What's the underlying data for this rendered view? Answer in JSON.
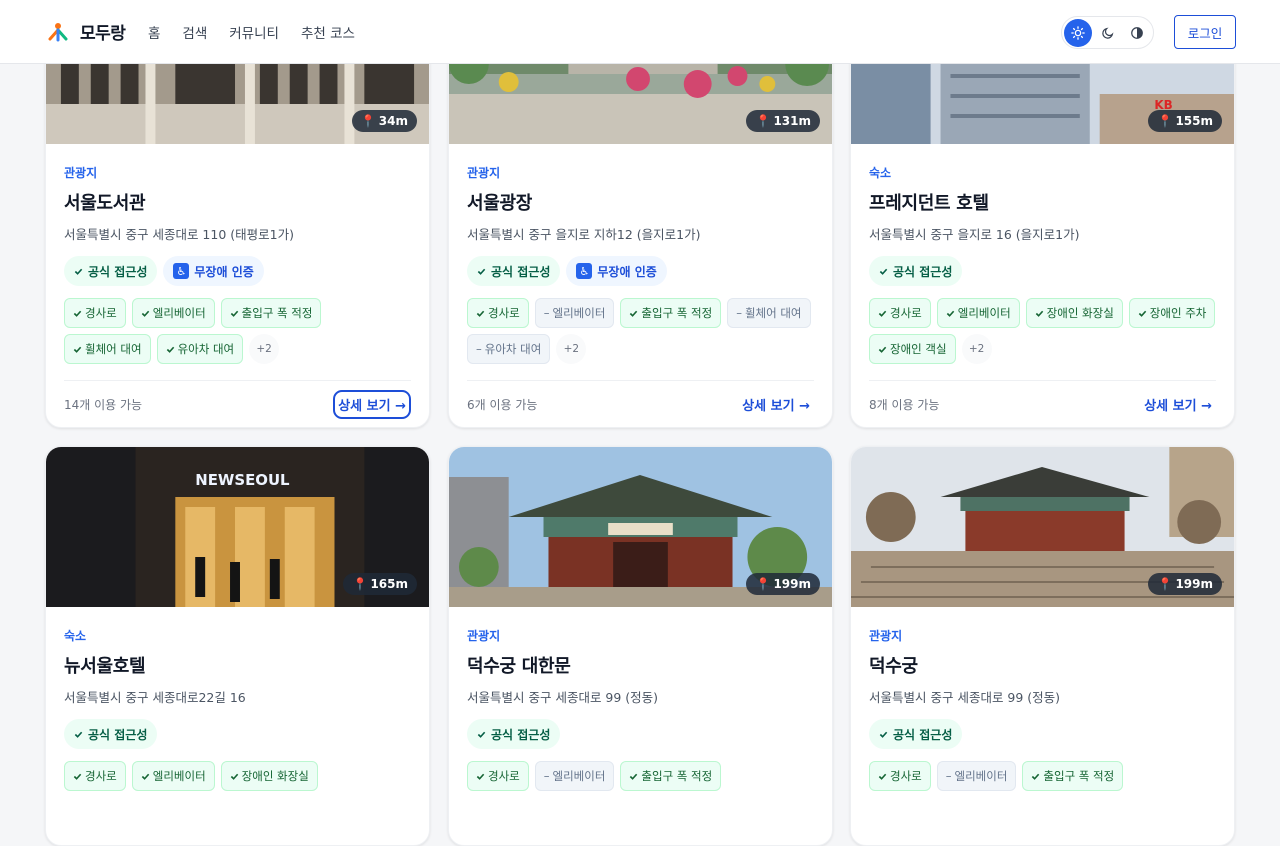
{
  "header": {
    "logo_text": "모두랑",
    "nav": [
      "홈",
      "검색",
      "커뮤니티",
      "추천 코스"
    ],
    "login_label": "로그인"
  },
  "colors": {
    "accent": "#2563eb",
    "green": "#065f46",
    "chip_ok_bg": "#ecfdf5"
  },
  "cards": [
    {
      "category": "관광지",
      "name": "서울도서관",
      "address": "서울특별시 중구 세종대로 110 (태평로1가)",
      "distance": "34m",
      "badges": [
        {
          "label": "공식 접근성",
          "kind": "green",
          "icon": "check-icon"
        },
        {
          "label": "무장애 인증",
          "kind": "blue",
          "icon": "wheelchair-icon"
        }
      ],
      "chips": [
        {
          "label": "경사로",
          "ok": true
        },
        {
          "label": "엘리베이터",
          "ok": true
        },
        {
          "label": "출입구 폭 적정",
          "ok": true
        },
        {
          "label": "휠체어 대여",
          "ok": true
        },
        {
          "label": "유아차 대여",
          "ok": true
        }
      ],
      "more": "+2",
      "available": "14개 이용 가능",
      "detail_label": "상세 보기 →",
      "focused": true
    },
    {
      "category": "관광지",
      "name": "서울광장",
      "address": "서울특별시 중구 을지로 지하12 (을지로1가)",
      "distance": "131m",
      "badges": [
        {
          "label": "공식 접근성",
          "kind": "green",
          "icon": "check-icon"
        },
        {
          "label": "무장애 인증",
          "kind": "blue",
          "icon": "wheelchair-icon"
        }
      ],
      "chips": [
        {
          "label": "경사로",
          "ok": true
        },
        {
          "label": "엘리베이터",
          "ok": false
        },
        {
          "label": "출입구 폭 적정",
          "ok": true
        },
        {
          "label": "휠체어 대여",
          "ok": false
        },
        {
          "label": "유아차 대여",
          "ok": false
        }
      ],
      "more": "+2",
      "available": "6개 이용 가능",
      "detail_label": "상세 보기 →",
      "focused": false
    },
    {
      "category": "숙소",
      "name": "프레지던트 호텔",
      "address": "서울특별시 중구 을지로 16 (을지로1가)",
      "distance": "155m",
      "badges": [
        {
          "label": "공식 접근성",
          "kind": "green",
          "icon": "check-icon"
        }
      ],
      "chips": [
        {
          "label": "경사로",
          "ok": true
        },
        {
          "label": "엘리베이터",
          "ok": true
        },
        {
          "label": "장애인 화장실",
          "ok": true
        },
        {
          "label": "장애인 주차",
          "ok": true
        },
        {
          "label": "장애인 객실",
          "ok": true
        }
      ],
      "more": "+2",
      "available": "8개 이용 가능",
      "detail_label": "상세 보기 →",
      "focused": false
    },
    {
      "category": "숙소",
      "name": "뉴서울호텔",
      "address": "서울특별시 중구 세종대로22길 16",
      "distance": "165m",
      "badges": [
        {
          "label": "공식 접근성",
          "kind": "green",
          "icon": "check-icon"
        }
      ],
      "chips": [
        {
          "label": "경사로",
          "ok": true
        },
        {
          "label": "엘리베이터",
          "ok": true
        },
        {
          "label": "장애인 화장실",
          "ok": true
        }
      ],
      "more": "",
      "available": "",
      "detail_label": "",
      "focused": false
    },
    {
      "category": "관광지",
      "name": "덕수궁 대한문",
      "address": "서울특별시 중구 세종대로 99 (정동)",
      "distance": "199m",
      "badges": [
        {
          "label": "공식 접근성",
          "kind": "green",
          "icon": "check-icon"
        }
      ],
      "chips": [
        {
          "label": "경사로",
          "ok": true
        },
        {
          "label": "엘리베이터",
          "ok": false
        },
        {
          "label": "출입구 폭 적정",
          "ok": true
        }
      ],
      "more": "",
      "available": "",
      "detail_label": "",
      "focused": false
    },
    {
      "category": "관광지",
      "name": "덕수궁",
      "address": "서울특별시 중구 세종대로 99 (정동)",
      "distance": "199m",
      "badges": [
        {
          "label": "공식 접근성",
          "kind": "green",
          "icon": "check-icon"
        }
      ],
      "chips": [
        {
          "label": "경사로",
          "ok": true
        },
        {
          "label": "엘리베이터",
          "ok": false
        },
        {
          "label": "출입구 폭 적정",
          "ok": true
        }
      ],
      "more": "",
      "available": "",
      "detail_label": "",
      "focused": false
    }
  ]
}
